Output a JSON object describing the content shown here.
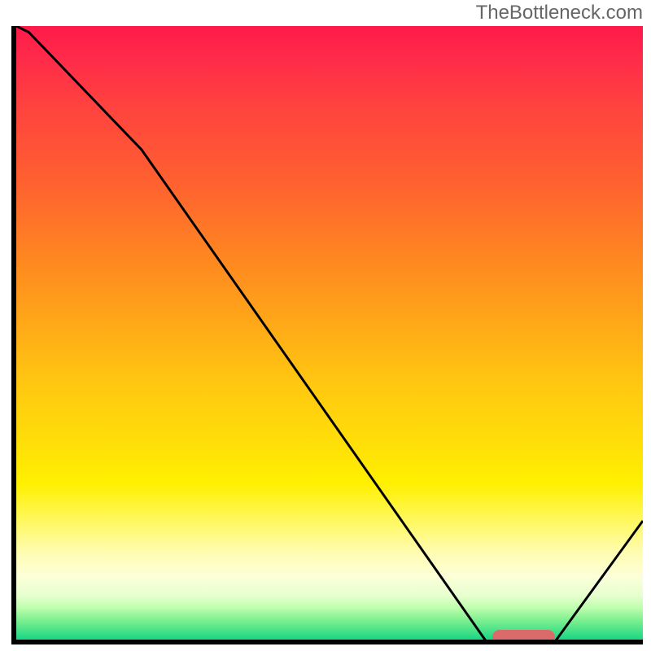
{
  "watermark": "TheBottleneck.com",
  "chart_data": {
    "type": "line",
    "title": "",
    "xlabel": "",
    "ylabel": "",
    "x": [
      0.0,
      0.02,
      0.2,
      0.75,
      0.8,
      0.86,
      1.0
    ],
    "values": [
      1.0,
      0.99,
      0.8,
      0.005,
      0.0,
      0.005,
      0.2
    ],
    "ylim": [
      0,
      1
    ],
    "xlim": [
      0,
      1
    ],
    "marker_range": [
      0.76,
      0.86
    ],
    "gradient_stops": [
      {
        "pos": 0.0,
        "color": "#ff1a4a"
      },
      {
        "pos": 0.25,
        "color": "#ff6030"
      },
      {
        "pos": 0.5,
        "color": "#ffb018"
      },
      {
        "pos": 0.75,
        "color": "#fff000"
      },
      {
        "pos": 0.9,
        "color": "#fdffd0"
      },
      {
        "pos": 1.0,
        "color": "#00d080"
      }
    ]
  }
}
